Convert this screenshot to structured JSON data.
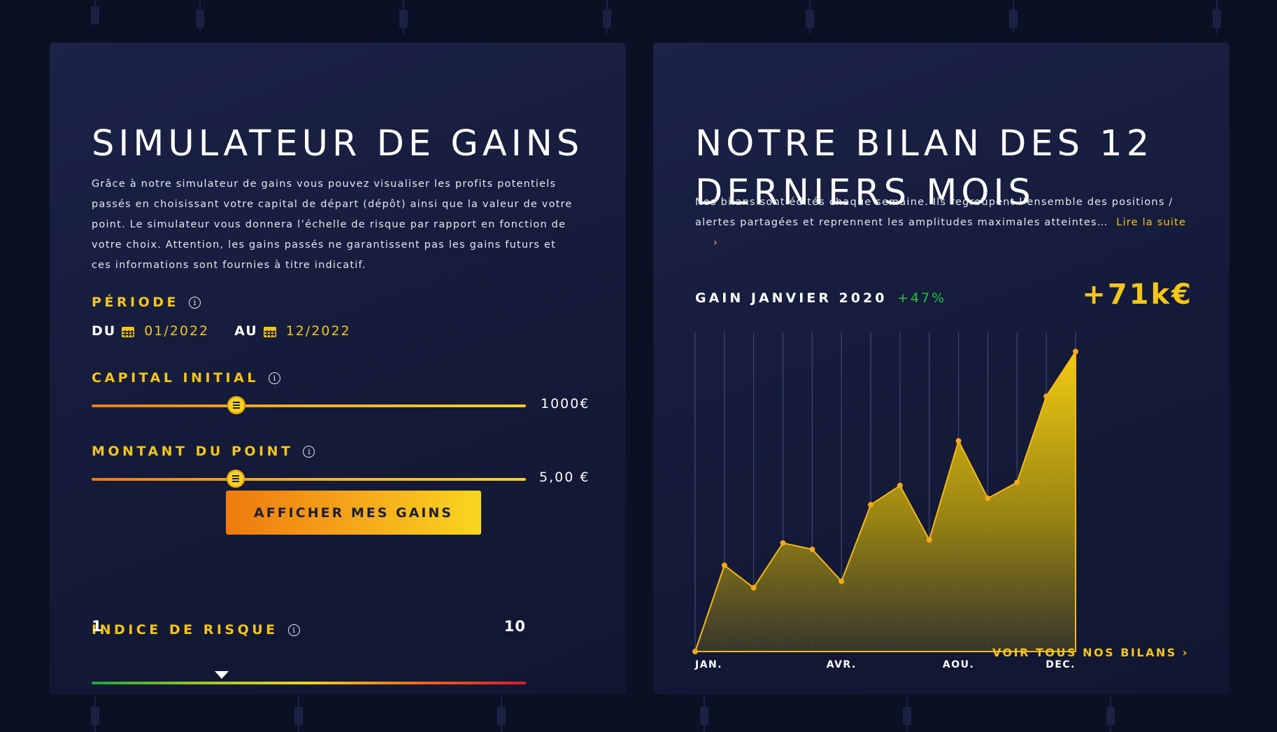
{
  "simulator": {
    "title": "SIMULATEUR DE GAINS",
    "description": "Grâce à notre simulateur de gains vous pouvez visualiser les profits potentiels passés en choisissant votre capital de départ (dépôt) ainsi que la valeur de votre point. Le simulateur vous donnera l’échelle de risque par rapport en fonction de votre choix. Attention, les gains passés ne garantissent pas les gains futurs et ces informations sont fournies à titre indicatif.",
    "period": {
      "label": "PÉRIODE",
      "from_label": "DU",
      "from_value": "01/2022",
      "to_label": "AU",
      "to_value": "12/2022"
    },
    "capital": {
      "label": "CAPITAL INITIAL",
      "value": "1000€",
      "position": 0.333
    },
    "point": {
      "label": "MONTANT DU POINT",
      "value": "5,00 €",
      "position": 0.331
    },
    "cta_label": "AFFICHER MES GAINS",
    "risk": {
      "label": "INDICE DE RISQUE",
      "min": "1",
      "max": "10",
      "level": 3.7
    },
    "info_glyph": "i"
  },
  "report": {
    "title_line1": "NOTRE BILAN DES 12",
    "title_line2": "DERNIERS MOIS",
    "description": "Nos bilans sont édités chaque semaine. Ils regroupent l’ensemble des positions / alertes partagées et reprennent les amplitudes maximales atteintes…",
    "read_more": "Lire la suite",
    "read_more_arrow": "›",
    "gain_label": "GAIN JANVIER 2020",
    "gain_pct": "+47%",
    "gain_total": "+71k€",
    "see_all": "VOIR TOUS NOS BILANS ›"
  },
  "chart_data": {
    "type": "area",
    "x_tick_labels": [
      "JAN.",
      "AVR.",
      "AOU.",
      "DEC."
    ],
    "x_tick_index": [
      0,
      5,
      9,
      13
    ],
    "points": [
      0,
      27,
      20,
      34,
      32,
      22,
      46,
      52,
      35,
      66,
      48,
      53,
      80,
      94
    ],
    "ylim": [
      0,
      100
    ],
    "grid": "vertical",
    "fill_color": "#e8c010",
    "line_color": "#f5b81a",
    "dot_color": "#f5a81a"
  },
  "colors": {
    "accent": "#f5c518",
    "background": "#0b1024",
    "card": "#171e40",
    "positive": "#23c53e"
  }
}
